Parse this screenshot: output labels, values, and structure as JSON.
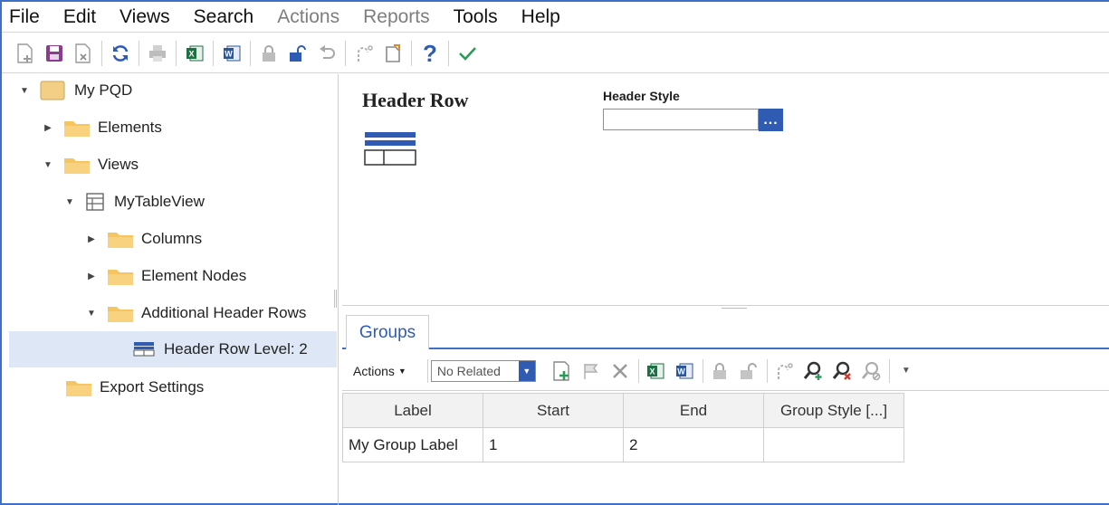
{
  "menu": {
    "items": [
      {
        "label": "File",
        "disabled": false
      },
      {
        "label": "Edit",
        "disabled": false
      },
      {
        "label": "Views",
        "disabled": false
      },
      {
        "label": "Search",
        "disabled": false
      },
      {
        "label": "Actions",
        "disabled": true
      },
      {
        "label": "Reports",
        "disabled": true
      },
      {
        "label": "Tools",
        "disabled": false
      },
      {
        "label": "Help",
        "disabled": false
      }
    ]
  },
  "toolbar": {
    "icons": [
      "new-icon",
      "save-icon",
      "close-doc-icon",
      "refresh-icon",
      "print-icon",
      "excel-icon",
      "word-icon",
      "lock-icon",
      "unlock-icon",
      "undo-icon",
      "redo-icon",
      "clipboard-icon",
      "help-icon",
      "check-icon"
    ]
  },
  "tree": {
    "root": {
      "label": "My PQD"
    },
    "elements": {
      "label": "Elements"
    },
    "views": {
      "label": "Views"
    },
    "table_view": {
      "label": "MyTableView"
    },
    "columns": {
      "label": "Columns"
    },
    "element_nodes": {
      "label": "Element Nodes"
    },
    "additional_header_rows": {
      "label": "Additional Header Rows"
    },
    "header_row_level": {
      "label": "Header Row Level: 2"
    },
    "export_settings": {
      "label": "Export Settings"
    }
  },
  "detail": {
    "title": "Header Row",
    "header_style_label": "Header Style",
    "header_style_value": "",
    "browse_label": "..."
  },
  "groups": {
    "tab_label": "Groups",
    "actions_label": "Actions",
    "related_combo": "No Related",
    "columns": [
      "Label",
      "Start",
      "End",
      "Group Style [...]"
    ],
    "rows": [
      {
        "label": "My Group Label",
        "start": "1",
        "end": "2",
        "style": ""
      }
    ]
  },
  "colors": {
    "accent": "#2f5bb3",
    "frame": "#3f6fc6",
    "selected": "#dde7f5",
    "folder": "#f0c060"
  }
}
